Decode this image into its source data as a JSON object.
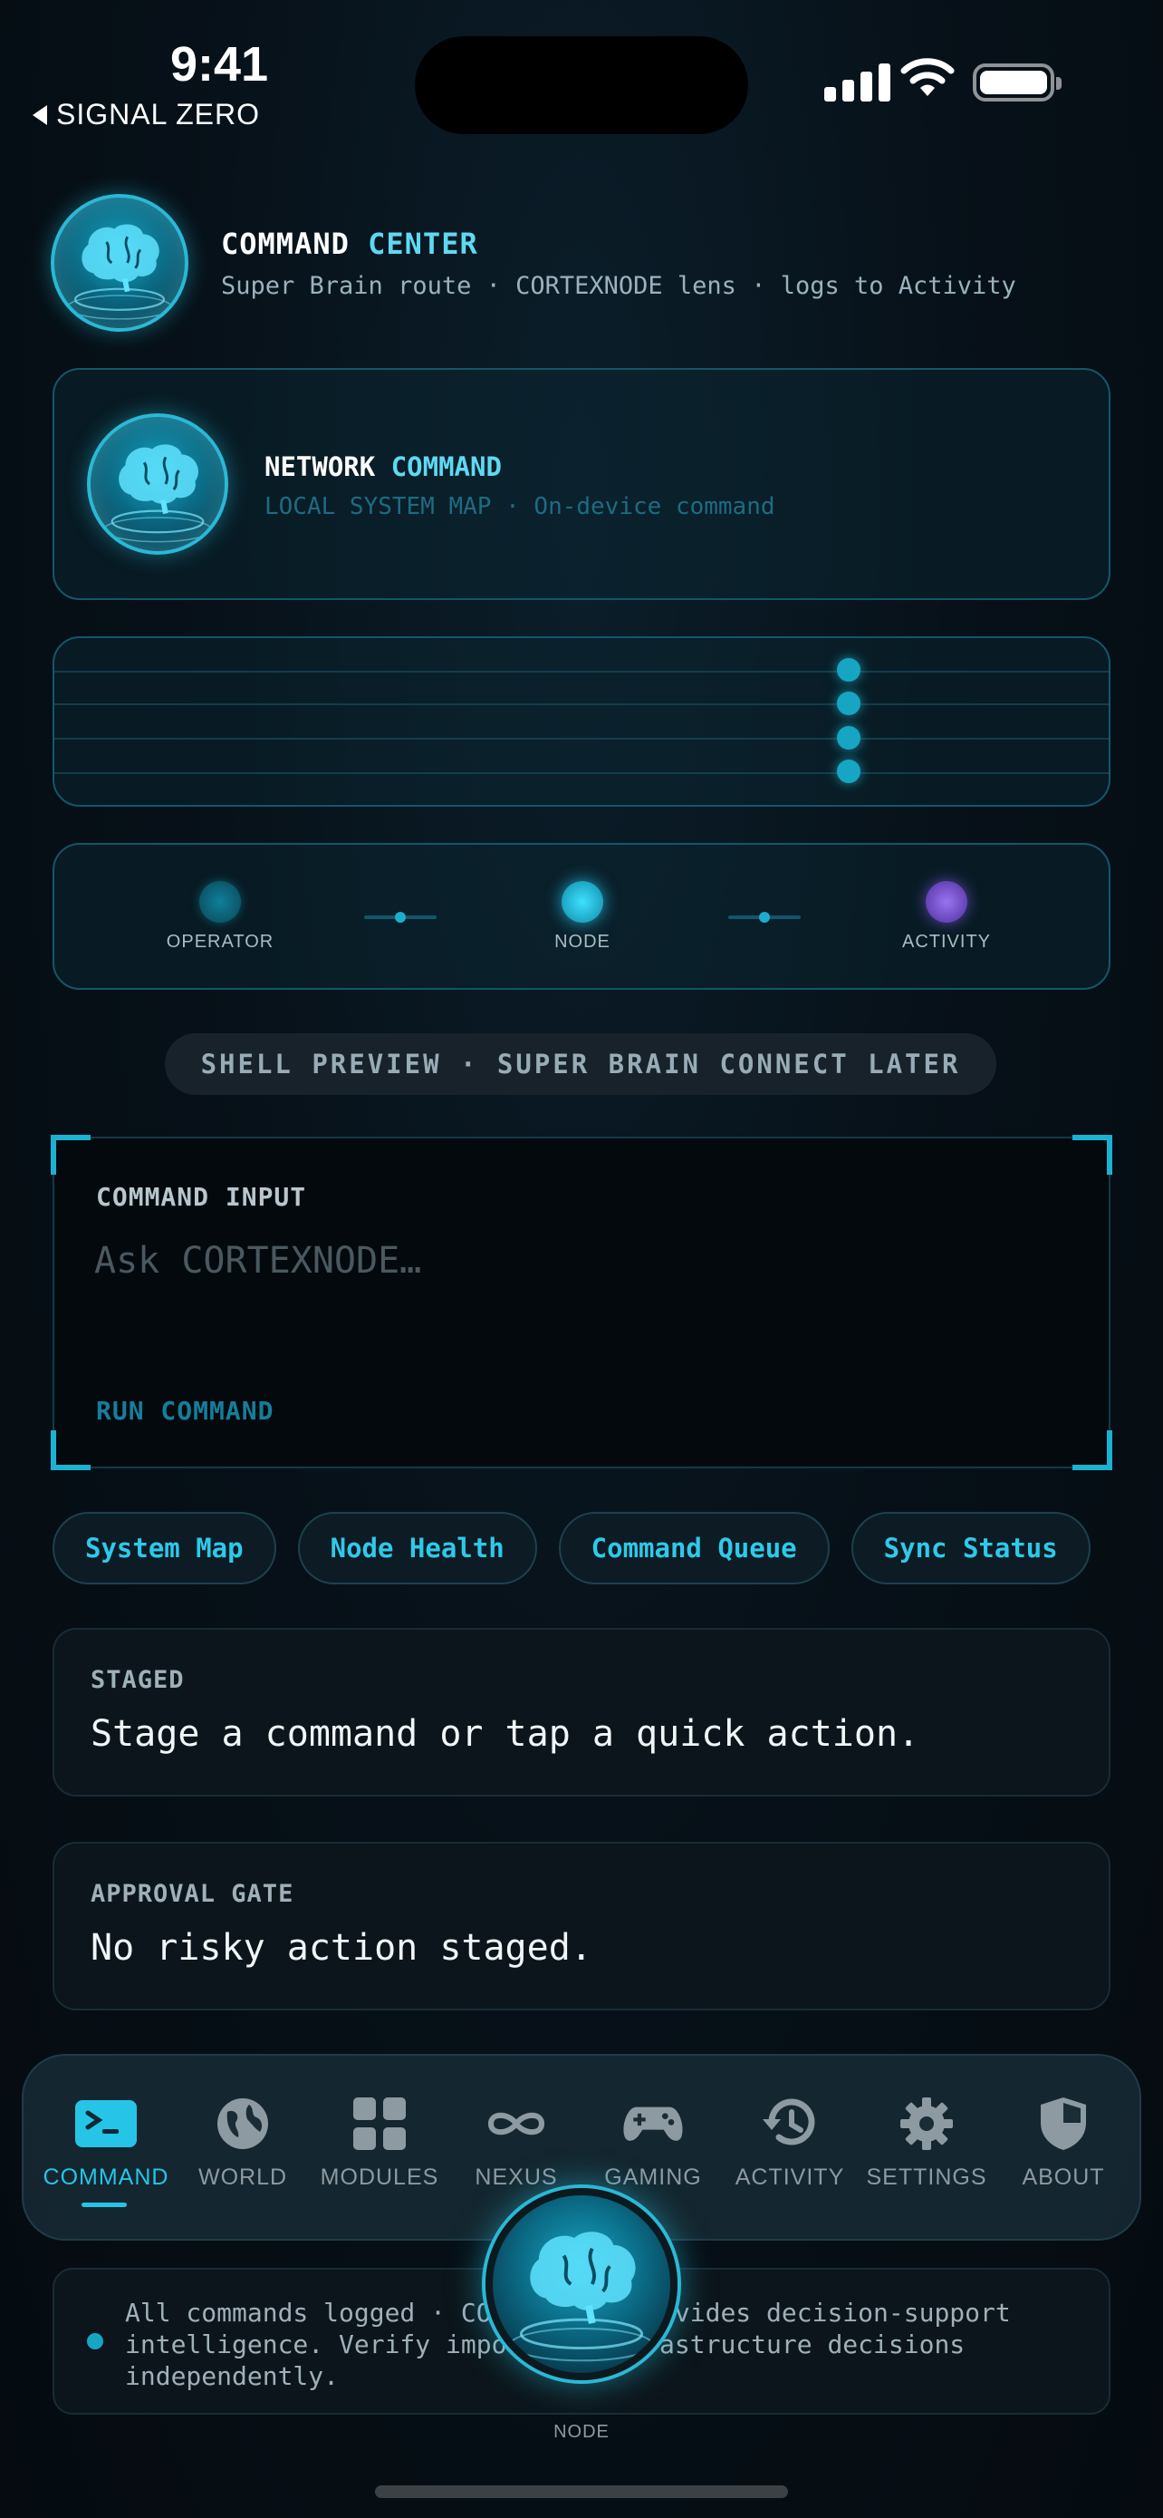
{
  "status_bar": {
    "time": "9:41",
    "back_label": "SIGNAL ZERO"
  },
  "header": {
    "title_part1": "COMMAND",
    "title_part2": "CENTER",
    "subtitle": "Super Brain route · CORTEXNODE lens · logs to Activity"
  },
  "network": {
    "title_part1": "NETWORK",
    "title_part2": "COMMAND",
    "subtitle": "LOCAL SYSTEM MAP · On-device command"
  },
  "flow": {
    "operator": "OPERATOR",
    "node": "NODE",
    "activity": "ACTIVITY",
    "colors": {
      "operator": "#0e6f86",
      "node": "#17b5d6",
      "activity": "#7b4fd6"
    }
  },
  "shell_note": "SHELL PREVIEW · SUPER BRAIN CONNECT LATER",
  "command": {
    "label": "COMMAND INPUT",
    "placeholder": "Ask CORTEXNODE…",
    "value": "",
    "run_label": "RUN COMMAND"
  },
  "quick_actions": [
    "System Map",
    "Node Health",
    "Command Queue",
    "Sync Status"
  ],
  "staged": {
    "label": "STAGED",
    "text": "Stage a command or tap a quick action."
  },
  "approval": {
    "label": "APPROVAL GATE",
    "text": "No risky action staged."
  },
  "tabs": [
    {
      "label": "COMMAND",
      "icon": "terminal-icon",
      "active": true
    },
    {
      "label": "WORLD",
      "icon": "globe-icon",
      "active": false
    },
    {
      "label": "MODULES",
      "icon": "grid-icon",
      "active": false
    },
    {
      "label": "NEXUS",
      "icon": "infinity-icon",
      "active": false
    },
    {
      "label": "GAMING",
      "icon": "gamepad-icon",
      "active": false
    },
    {
      "label": "ACTIVITY",
      "icon": "history-icon",
      "active": false
    },
    {
      "label": "SETTINGS",
      "icon": "gear-icon",
      "active": false
    },
    {
      "label": "ABOUT",
      "icon": "shield-icon",
      "active": false
    }
  ],
  "footer": {
    "text": "All commands logged · CORTEXNODE provides decision-support intelligence. Verify important infrastructure decisions independently."
  },
  "node_label": "NODE",
  "accent": "#26c5e8"
}
